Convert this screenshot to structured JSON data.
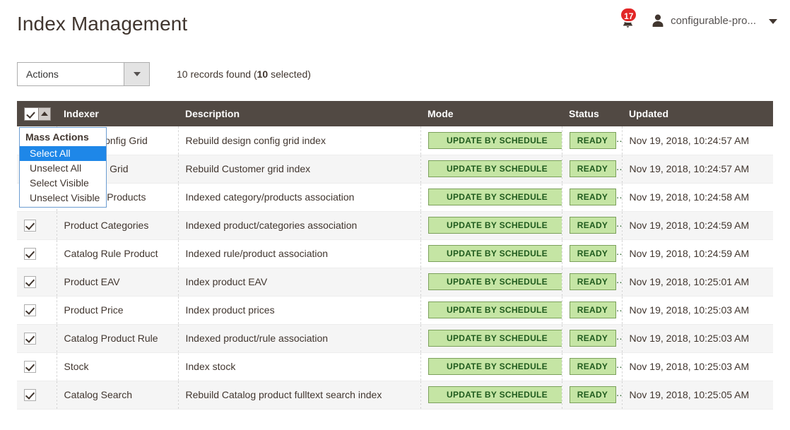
{
  "header": {
    "title": "Index Management",
    "notifications": {
      "icon": "bell-icon",
      "count": "17"
    },
    "user": {
      "avatar_icon": "user-avatar-icon",
      "name": "configurable-pro...",
      "caret_icon": "chevron-down-icon"
    }
  },
  "toolbar": {
    "actions_label": "Actions",
    "actions_arrow_icon": "chevron-down-icon",
    "records_prefix": "10 records found (",
    "records_count": "10",
    "records_suffix": " selected)"
  },
  "mass_actions_menu": {
    "title": "Mass Actions",
    "items": [
      {
        "label": "Select All",
        "selected": true
      },
      {
        "label": "Unselect All",
        "selected": false
      },
      {
        "label": "Select Visible",
        "selected": false
      },
      {
        "label": "Unselect Visible",
        "selected": false
      }
    ]
  },
  "grid": {
    "select_all_icon": "checkbox-checked-icon",
    "select_all_caret_icon": "caret-up-icon",
    "columns": [
      {
        "key": "checkbox",
        "label": ""
      },
      {
        "key": "indexer",
        "label": "Indexer"
      },
      {
        "key": "description",
        "label": "Description"
      },
      {
        "key": "mode",
        "label": "Mode"
      },
      {
        "key": "status",
        "label": "Status"
      },
      {
        "key": "updated",
        "label": "Updated"
      }
    ],
    "rows": [
      {
        "checked": true,
        "indexer": "Design Config Grid",
        "description": "Rebuild design config grid index",
        "mode": "UPDATE BY SCHEDULE",
        "status": "READY",
        "updated": "Nov 19, 2018, 10:24:57 AM"
      },
      {
        "checked": true,
        "indexer": "Customer Grid",
        "description": "Rebuild Customer grid index",
        "mode": "UPDATE BY SCHEDULE",
        "status": "READY",
        "updated": "Nov 19, 2018, 10:24:57 AM"
      },
      {
        "checked": false,
        "indexer": "Category Products",
        "description": "Indexed category/products association",
        "mode": "UPDATE BY SCHEDULE",
        "status": "READY",
        "updated": "Nov 19, 2018, 10:24:58 AM"
      },
      {
        "checked": true,
        "indexer": "Product Categories",
        "description": "Indexed product/categories association",
        "mode": "UPDATE BY SCHEDULE",
        "status": "READY",
        "updated": "Nov 19, 2018, 10:24:59 AM"
      },
      {
        "checked": true,
        "indexer": "Catalog Rule Product",
        "description": "Indexed rule/product association",
        "mode": "UPDATE BY SCHEDULE",
        "status": "READY",
        "updated": "Nov 19, 2018, 10:24:59 AM"
      },
      {
        "checked": true,
        "indexer": "Product EAV",
        "description": "Index product EAV",
        "mode": "UPDATE BY SCHEDULE",
        "status": "READY",
        "updated": "Nov 19, 2018, 10:25:01 AM"
      },
      {
        "checked": true,
        "indexer": "Product Price",
        "description": "Index product prices",
        "mode": "UPDATE BY SCHEDULE",
        "status": "READY",
        "updated": "Nov 19, 2018, 10:25:03 AM"
      },
      {
        "checked": true,
        "indexer": "Catalog Product Rule",
        "description": "Indexed product/rule association",
        "mode": "UPDATE BY SCHEDULE",
        "status": "READY",
        "updated": "Nov 19, 2018, 10:25:03 AM"
      },
      {
        "checked": true,
        "indexer": "Stock",
        "description": "Index stock",
        "mode": "UPDATE BY SCHEDULE",
        "status": "READY",
        "updated": "Nov 19, 2018, 10:25:03 AM"
      },
      {
        "checked": true,
        "indexer": "Catalog Search",
        "description": "Rebuild Catalog product fulltext search index",
        "mode": "UPDATE BY SCHEDULE",
        "status": "READY",
        "updated": "Nov 19, 2018, 10:25:05 AM"
      }
    ]
  },
  "colors": {
    "header_bar": "#514943",
    "badge_bg": "#c5e5a4",
    "badge_border": "#7ba05b",
    "badge_text": "#205b1e",
    "notif_badge": "#e22626",
    "menu_selected": "#1e87e8",
    "text": "#41362f"
  }
}
